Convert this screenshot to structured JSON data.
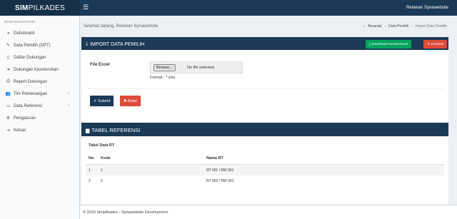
{
  "app": {
    "logo_bold": "SIM",
    "logo_light": "PILKADES",
    "menu_icon": "hamburger-icon",
    "user_name": "Relawan Synawebsite"
  },
  "sidebar": {
    "header": "MAIN NAVIGATION",
    "items": [
      {
        "label": "Dahsboard",
        "icon": "dashboard-icon",
        "glyph": "◕"
      },
      {
        "label": "Data Pemilih (DPT)",
        "icon": "edit-icon",
        "glyph": "✎"
      },
      {
        "label": "Daftar Dukungan",
        "icon": "document-icon",
        "glyph": "▯"
      },
      {
        "label": "Dukungan Keseluruhan",
        "icon": "sign-in-icon",
        "glyph": "➜"
      },
      {
        "label": "Report Dukungan",
        "icon": "print-icon",
        "glyph": "⎙"
      },
      {
        "label": "Tim Pemenangan",
        "icon": "users-icon",
        "glyph": "👥",
        "chevron": "‹"
      },
      {
        "label": "Data Referensi",
        "icon": "folder-icon",
        "glyph": "▭",
        "chevron": "‹"
      },
      {
        "label": "Pengaturan",
        "icon": "gear-icon",
        "glyph": "⚙"
      },
      {
        "label": "Keluar",
        "icon": "logout-icon",
        "glyph": "⇥"
      }
    ]
  },
  "content": {
    "greeting": "Selamat datang, Relawan Synawebsite",
    "breadcrumb": {
      "home": "Beranda",
      "sep": "›",
      "middle": "Data Pemilih",
      "active": "Import Data Pemilih"
    },
    "import_box": {
      "title": "IMPORT DATA PEMILIH",
      "download_button": "Download Format Excel",
      "back_button": "Kembali",
      "file_label": "File Excel",
      "browse_label": "Browse...",
      "no_file_text": "No file selected.",
      "format_text": "Format : *.xlsx",
      "submit_button": "Submit",
      "cancel_button": "Batal"
    },
    "ref_box": {
      "title": "TABEL REFERENSI",
      "table_title": "Tabel Data RT",
      "columns": [
        "No",
        "Kode",
        "Nama RT"
      ],
      "rows": [
        [
          "1",
          "1",
          "RT 001 / RW 001"
        ],
        [
          "2",
          "2",
          "RT 002 / RW 001"
        ]
      ]
    },
    "footer": "© 2019 Simpilkades - Synawebsite Development."
  },
  "colors": {
    "primary": "#1b3a57",
    "success": "#00a65a",
    "danger": "#dd4b39",
    "background": "#ecf0f5"
  }
}
